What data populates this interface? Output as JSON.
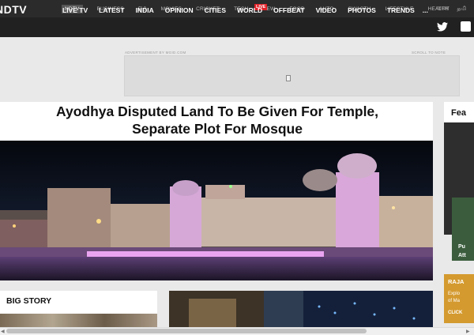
{
  "topbar": {
    "links": [
      "NDTV",
      "BUSINESS",
      "हिंदी",
      "MOVIES",
      "CRICKET",
      "TECH",
      "NEW",
      "FOOD",
      "AUTO",
      "SWASTH",
      "LIFESTYLE",
      "HEALTH"
    ],
    "live_badge": "LIVE",
    "right_links": [
      "বাংলা",
      "தமி"
    ]
  },
  "nav": {
    "logo": "NDTV",
    "items": [
      "LIVE TV",
      "LATEST",
      "INDIA",
      "OPINION",
      "CITIES",
      "WORLD",
      "OFFBEAT",
      "VIDEO",
      "PHOTOS",
      "TRENDS"
    ],
    "more": "...",
    "icons": [
      "twitter-icon",
      "facebook-icon"
    ]
  },
  "ad": {
    "label": "ADVERTISEMENT BY MGID.COM",
    "right_label": "SCROLL TO NOTE"
  },
  "article": {
    "headline_line1": "Ayodhya Disputed Land To Be Given For Temple,",
    "headline_line2": "Separate Plot For Mosque"
  },
  "sidebar": {
    "title": "Fea",
    "caption_line1": "Pu",
    "caption_line2": "Att",
    "promo_title": "RAJA",
    "promo_line1": "Explo",
    "promo_line2": "of Ma",
    "promo_cta": "CLICK"
  },
  "big_story": {
    "title": "BIG STORY"
  },
  "colors": {
    "topbar_bg": "#2b2b2b",
    "nav_bg": "#212121",
    "live_red": "#e21f26",
    "promo_orange": "#d49a2f"
  }
}
